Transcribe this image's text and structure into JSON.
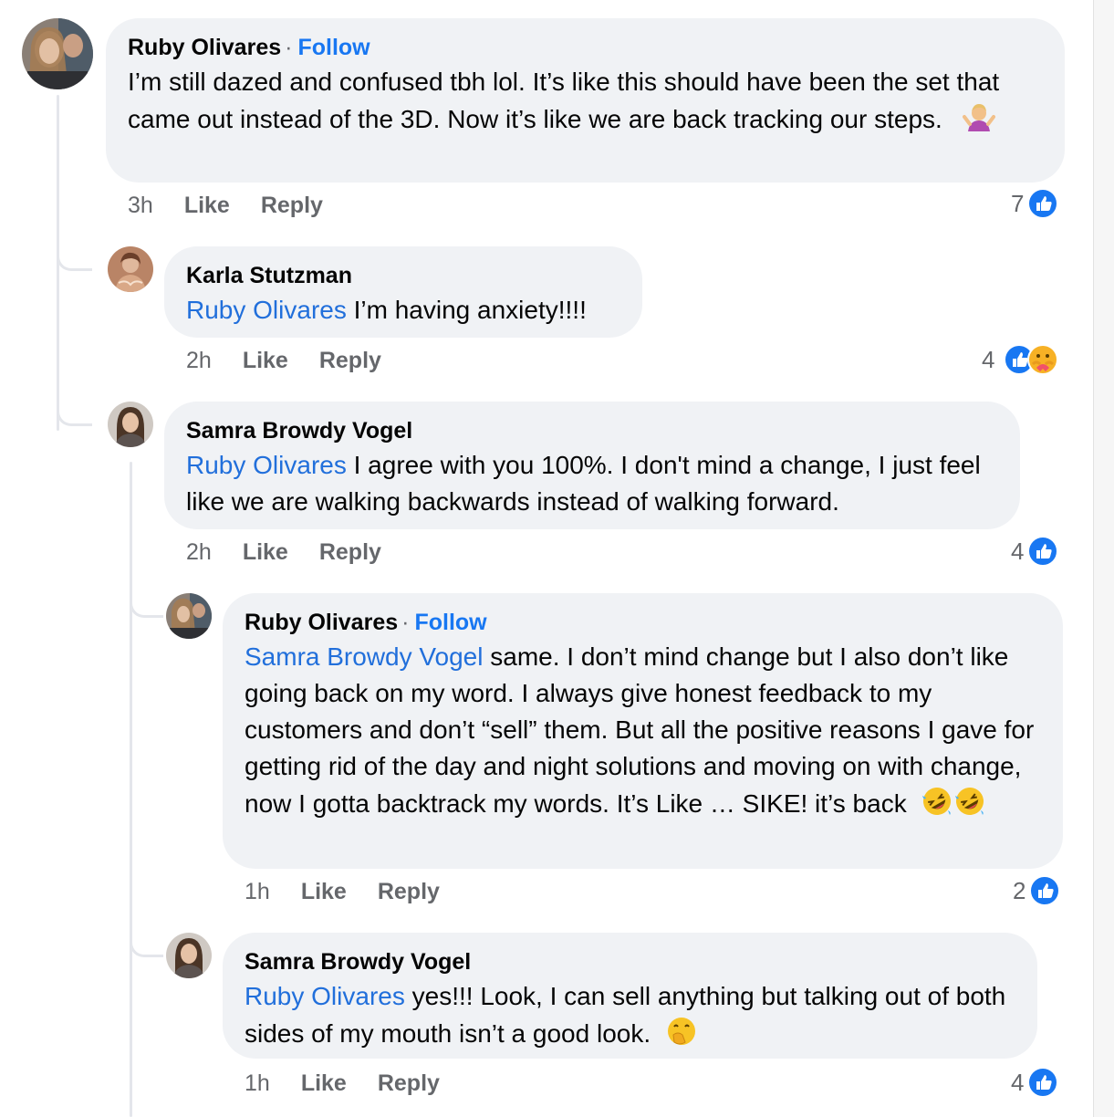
{
  "comments": [
    {
      "author": "Ruby Olivares",
      "separator": "·",
      "follow_label": "Follow",
      "text": "I’m still dazed and confused tbh lol.  It’s like this should have been the set that came out instead of the 3D. Now it’s like we are back tracking our steps.",
      "emoji": "person-shrugging-emoji",
      "time": "3h",
      "like_label": "Like",
      "reply_label": "Reply",
      "reaction_count": "7",
      "reactions": [
        "like"
      ]
    },
    {
      "author": "Karla Stutzman",
      "mention": "Ruby Olivares",
      "text": " I’m having anxiety!!!!",
      "time": "2h",
      "like_label": "Like",
      "reply_label": "Reply",
      "reaction_count": "4",
      "reactions": [
        "like",
        "care"
      ]
    },
    {
      "author": "Samra Browdy Vogel",
      "mention": "Ruby Olivares",
      "text": " I agree with you 100%. I don't mind a change, I just feel like we are walking backwards instead of walking forward.",
      "time": "2h",
      "like_label": "Like",
      "reply_label": "Reply",
      "reaction_count": "4",
      "reactions": [
        "like"
      ]
    },
    {
      "author": "Ruby Olivares",
      "separator": "·",
      "follow_label": "Follow",
      "mention": "Samra Browdy Vogel",
      "text": " same. I don’t mind change but I also don’t like going back on my word. I always give honest feedback to my customers and don’t “sell” them. But all the positive reasons I gave for getting rid of the day and night solutions and moving on with change, now I gotta backtrack my words. It’s Like … SIKE! it’s back",
      "emoji": "rolling-on-floor-laughing-emoji",
      "time": "1h",
      "like_label": "Like",
      "reply_label": "Reply",
      "reaction_count": "2",
      "reactions": [
        "like"
      ]
    },
    {
      "author": "Samra Browdy Vogel",
      "mention": "Ruby Olivares",
      "text": " yes!!! Look, I can sell anything but talking out of both sides of my mouth isn’t a good look.",
      "emoji": "face-with-hand-over-mouth-emoji",
      "time": "1h",
      "like_label": "Like",
      "reply_label": "Reply",
      "reaction_count": "4",
      "reactions": [
        "like"
      ]
    }
  ],
  "colors": {
    "bubble": "#f0f2f5",
    "link": "#216fdb",
    "meta": "#65676b",
    "like_blue": "#1877f2",
    "thread": "#e4e6eb"
  }
}
